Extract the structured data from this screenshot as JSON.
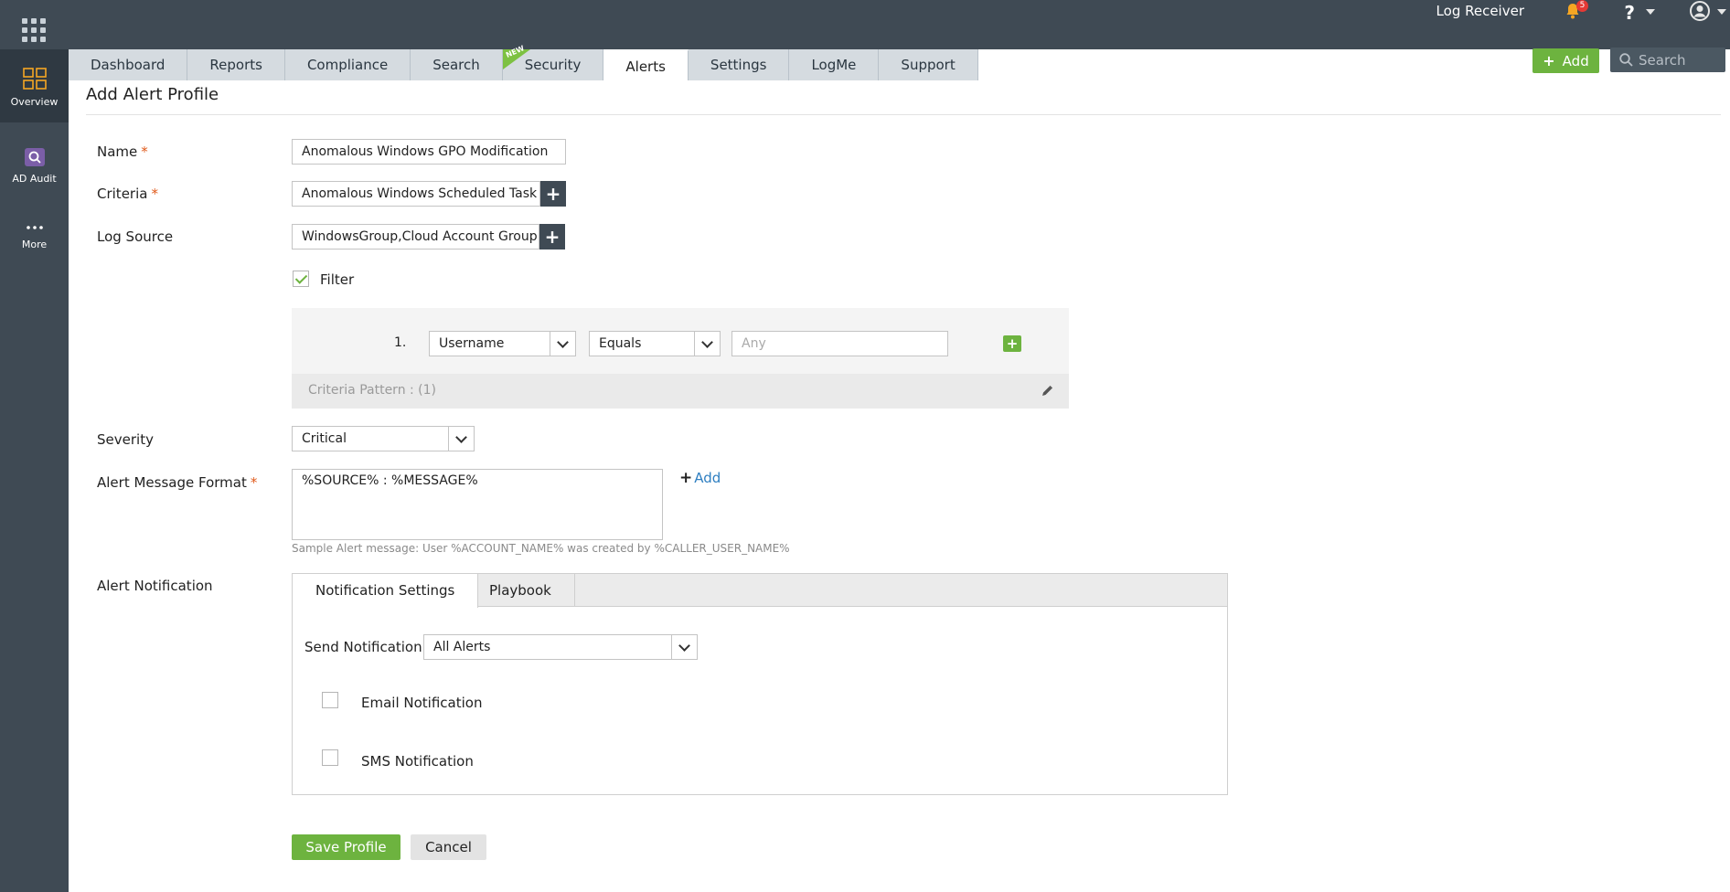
{
  "header": {
    "app_label": "Log Receiver",
    "notification_count": "5",
    "help_label": "?",
    "add_label": "Add",
    "search_placeholder": "Search"
  },
  "tabs": [
    {
      "label": "Dashboard"
    },
    {
      "label": "Reports"
    },
    {
      "label": "Compliance"
    },
    {
      "label": "Search"
    },
    {
      "label": "Security",
      "badge": "NEW"
    },
    {
      "label": "Alerts",
      "active": true
    },
    {
      "label": "Settings"
    },
    {
      "label": "LogMe"
    },
    {
      "label": "Support"
    }
  ],
  "sidebar": {
    "items": [
      {
        "label": "Overview",
        "icon": "overview-grid-icon",
        "active": true
      },
      {
        "label": "AD Audit",
        "icon": "ad-audit-icon"
      },
      {
        "label": "More",
        "icon": "more-dots-icon"
      }
    ]
  },
  "form": {
    "title": "Add Alert Profile",
    "required_mark": "*",
    "name_label": "Name",
    "name_value": "Anomalous Windows GPO Modification",
    "criteria_label": "Criteria",
    "criteria_value": "Anomalous Windows Scheduled Task",
    "log_source_label": "Log Source",
    "log_source_value": "WindowsGroup,Cloud Account Group",
    "plus_glyph": "+",
    "filter_label": "Filter",
    "filter_checked": true,
    "filter_row": {
      "index": "1.",
      "field": "Username",
      "operator": "Equals",
      "value_placeholder": "Any"
    },
    "criteria_pattern": "Criteria Pattern : (1)",
    "severity_label": "Severity",
    "severity_value": "Critical",
    "message_label": "Alert Message Format",
    "message_value": "%SOURCE% : %MESSAGE%",
    "message_add": "Add",
    "sample_message": "Sample Alert message: User %ACCOUNT_NAME% was created by %CALLER_USER_NAME%",
    "notification_label": "Alert Notification",
    "notification_tabs": [
      "Notification Settings",
      "Playbook"
    ],
    "send_notification_label": "Send Notification",
    "send_notification_value": "All Alerts",
    "email_label": "Email Notification",
    "sms_label": "SMS Notification",
    "save_label": "Save Profile",
    "cancel_label": "Cancel"
  },
  "colors": {
    "topbar": "#3f4a54",
    "accent_green": "#6db33f",
    "link_blue": "#2f7fc1",
    "required_orange": "#e05a1b"
  }
}
